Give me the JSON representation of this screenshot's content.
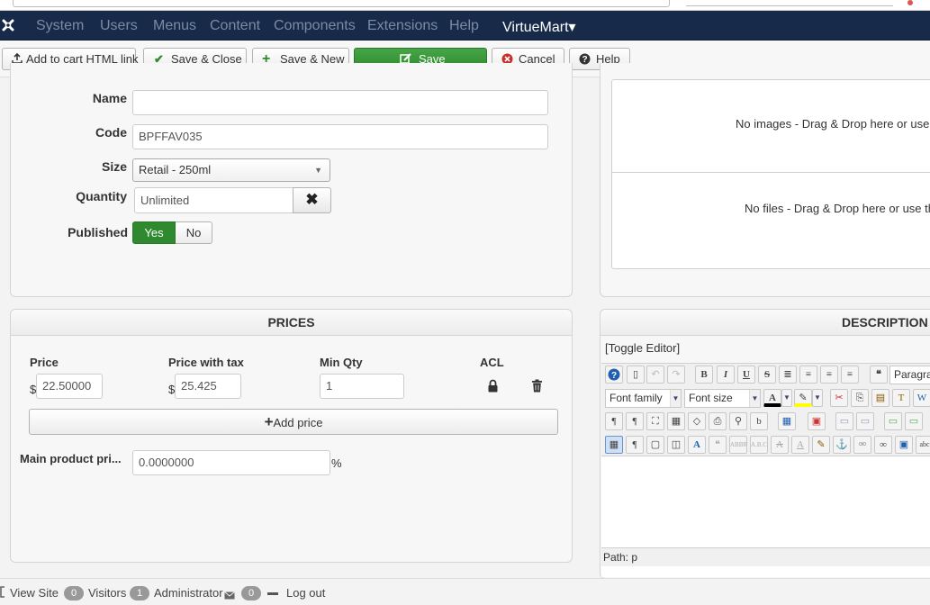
{
  "navbar": {
    "menu": [
      "System",
      "Users",
      "Menus",
      "Content",
      "Components",
      "Extensions",
      "Help"
    ],
    "active_menu": "VirtueMart",
    "dropdown_caret": "▾"
  },
  "toolbar": {
    "add_to_cart_label": "Add to cart HTML link",
    "save_close_label": "Save & Close",
    "save_new_label": "Save & New",
    "save_label": "Save",
    "cancel_label": "Cancel",
    "help_label": "Help"
  },
  "product_form": {
    "name_label": "Name",
    "name_value": "",
    "code_label": "Code",
    "code_value": "BPFFAV035",
    "size_label": "Size",
    "size_value": "Retail - 250ml",
    "quantity_label": "Quantity",
    "quantity_value": "Unlimited",
    "published_label": "Published",
    "published_yes": "Yes",
    "published_no": "No",
    "published_selected": "Yes"
  },
  "media": {
    "images_text": "No images - Drag & Drop here or use",
    "files_text": "No files - Drag & Drop here or use th"
  },
  "prices": {
    "title": "PRICES",
    "col_price": "Price",
    "col_price_tax": "Price with tax",
    "col_min_qty": "Min Qty",
    "col_acl": "ACL",
    "currency": "$",
    "price_value": "22.50000",
    "price_tax_value": "25.425",
    "min_qty_value": "1",
    "add_price_label": "Add price",
    "main_price_label": "Main product pri...",
    "main_price_value": "0.0000000",
    "percent_sign": "%"
  },
  "description": {
    "title": "DESCRIPTION",
    "toggle_label": "[Toggle Editor]",
    "font_family": "Font family",
    "font_size": "Font size",
    "paragraph": "Paragrap",
    "path_label": "Path:",
    "path_value": "p"
  },
  "statusbar": {
    "view_site": "View Site",
    "visitors_count": "0",
    "visitors_label": "Visitors",
    "admin_count": "1",
    "admin_label": "Administrator",
    "messages_count": "0",
    "logout_label": "Log out"
  },
  "colors": {
    "navbar": "#172a4a",
    "save_green": "#2f8a2f",
    "cancel_red": "#c9302c",
    "panel_bg": "#f7f7f7"
  }
}
